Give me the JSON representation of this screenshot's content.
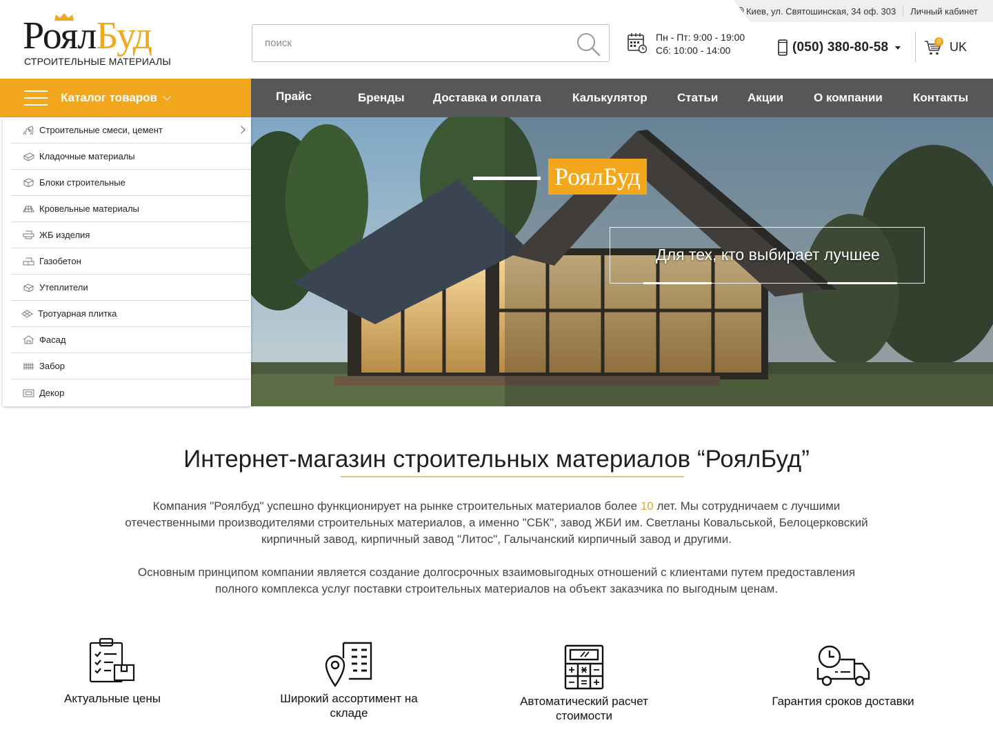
{
  "topbar": {
    "address": "Киев, ул. Святошинская, 34 оф. 303",
    "account_label": "Личный кабинет"
  },
  "logo": {
    "word_dark": "Роял",
    "word_accent": "Буд",
    "tagline": "СТРОИТЕЛЬНЫЕ МАТЕРИАЛЫ"
  },
  "search": {
    "placeholder": "поиск",
    "value": ""
  },
  "hours": {
    "weekdays": "Пн - Пт: 9:00 - 19:00",
    "saturday": "Сб: 10:00 - 14:00"
  },
  "phone": {
    "number": "(050) 380-80-58"
  },
  "cart": {
    "count": "0"
  },
  "language": "UK",
  "catalog_button": {
    "label": "Каталог товаров"
  },
  "nav": [
    {
      "label": "Прайс"
    },
    {
      "label": "Бренды"
    },
    {
      "label": "Доставка и оплата"
    },
    {
      "label": "Калькулятор"
    },
    {
      "label": "Статьи"
    },
    {
      "label": "Акции"
    },
    {
      "label": "О компании"
    },
    {
      "label": "Контакты"
    }
  ],
  "categories": [
    {
      "label": "Строительные смеси, цемент",
      "icon": "mixer-truck-icon",
      "has_submenu": true
    },
    {
      "label": "Кладочные материалы",
      "icon": "bricks-icon"
    },
    {
      "label": "Блоки строительные",
      "icon": "block-icon"
    },
    {
      "label": "Кровельные материалы",
      "icon": "roof-icon"
    },
    {
      "label": "ЖБ изделия",
      "icon": "concrete-slab-icon"
    },
    {
      "label": "Газобетон",
      "icon": "aerated-block-icon"
    },
    {
      "label": "Утеплители",
      "icon": "insulation-icon"
    },
    {
      "label": "Тротуарная плитка",
      "icon": "paving-tile-icon"
    },
    {
      "label": "Фасад",
      "icon": "facade-icon"
    },
    {
      "label": "Забор",
      "icon": "fence-icon"
    },
    {
      "label": "Декор",
      "icon": "decor-icon"
    }
  ],
  "hero": {
    "brand": "РоялБуд",
    "slogan": "Для тех, кто выбирает лучшее"
  },
  "about": {
    "title": "Интернет-магазин строительных материалов “РоялБуд”",
    "p1_before": "Компания \"Роялбуд\" успешно функционирует на рынке строительных материалов более ",
    "p1_highlight": "10",
    "p1_after": " лет. Мы сотрудничаем с лучшими отечественными производителями строительных материалов, а именно \"СБК\", завод ЖБИ им. Светланы Ковальськой, Белоцерковский кирпичный завод, кирпичный завод \"Литос\", Галычанский кирпичный завод и другими.",
    "p2": "Основным принципом компании является создание долгосрочных взаимовыгодных отношений с клиентами путем предоставления полного комплекса услуг поставки строительных материалов на объект заказчика по выгодным ценам."
  },
  "features": [
    {
      "label": "Актуальные цены",
      "icon": "clipboard-checklist-icon"
    },
    {
      "label": "Широкий ассортимент на складе",
      "icon": "map-pin-building-icon"
    },
    {
      "label": "Автоматический расчет стоимости",
      "icon": "calculator-icon"
    },
    {
      "label": "Гарантия сроков  доставки",
      "icon": "delivery-truck-icon"
    }
  ],
  "colors": {
    "accent": "#f2a71c",
    "nav_bg": "#575757",
    "highlight": "#e4a52b"
  }
}
